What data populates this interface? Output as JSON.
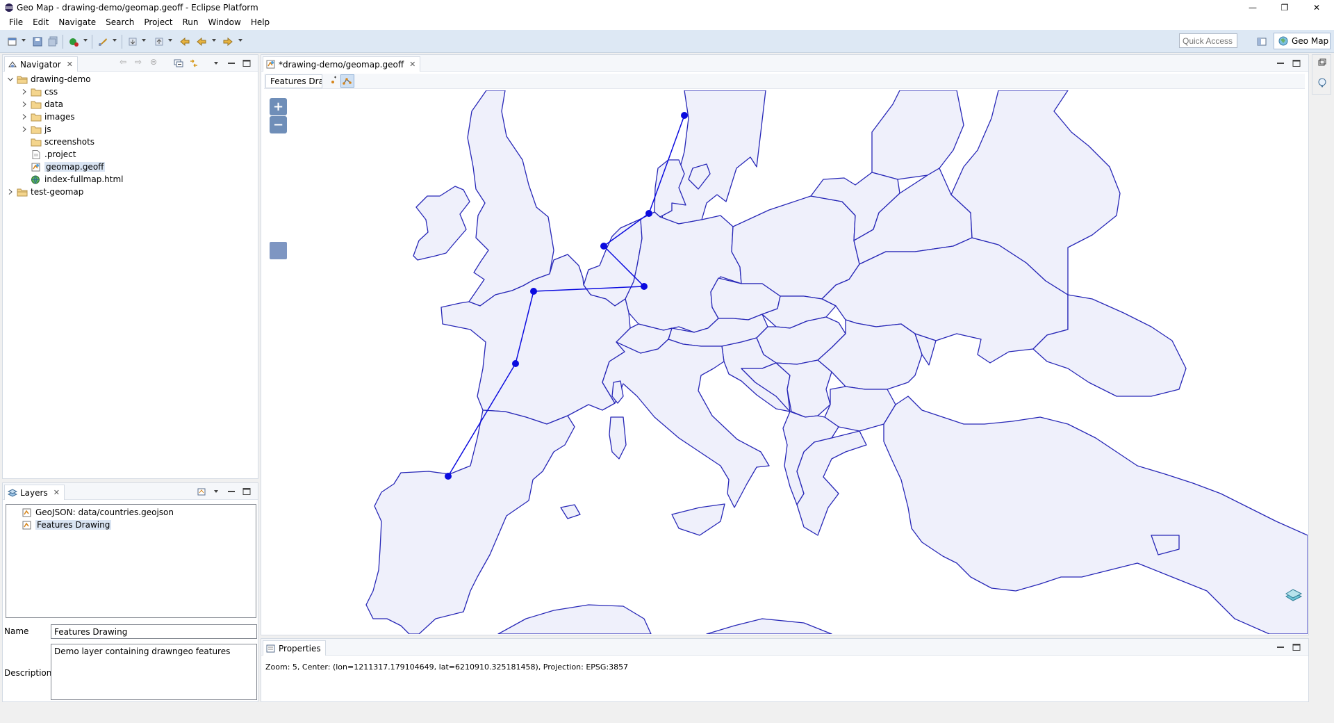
{
  "window": {
    "title": "Geo Map - drawing-demo/geomap.geoff - Eclipse Platform",
    "minimize": "—",
    "restore": "❐",
    "close": "✕"
  },
  "menu": [
    "File",
    "Edit",
    "Navigate",
    "Search",
    "Project",
    "Run",
    "Window",
    "Help"
  ],
  "toolbar": {
    "quick_access_placeholder": "Quick Access",
    "perspective_label": "Geo Map"
  },
  "navigator": {
    "tab_label": "Navigator",
    "tree": [
      {
        "label": "drawing-demo",
        "kind": "project",
        "expanded": true
      },
      {
        "label": "css",
        "kind": "folder"
      },
      {
        "label": "data",
        "kind": "folder"
      },
      {
        "label": "images",
        "kind": "folder"
      },
      {
        "label": "js",
        "kind": "folder"
      },
      {
        "label": "screenshots",
        "kind": "folder"
      },
      {
        "label": ".project",
        "kind": "file"
      },
      {
        "label": "geomap.geoff",
        "kind": "geoff",
        "selected": true
      },
      {
        "label": "index-fullmap.html",
        "kind": "html"
      },
      {
        "label": "test-geomap",
        "kind": "project",
        "expanded": false
      }
    ]
  },
  "layers": {
    "tab_label": "Layers",
    "items": [
      "GeoJSON: data/countries.geojson",
      "Features Drawing"
    ],
    "selected_index": 1,
    "name_label": "Name",
    "name_value": "Features Drawing",
    "description_label": "Description",
    "description_value": "Demo layer containing drawngeo features"
  },
  "editor": {
    "tab_label": "*drawing-demo/geomap.geoff",
    "toolbar_label": "Features Dra"
  },
  "map": {
    "zoom_in": "+",
    "zoom_out": "−",
    "fill_color": "#eff0fb",
    "border_color": "#2727b7",
    "feature_color": "#0b0bdf"
  },
  "properties": {
    "tab_label": "Properties",
    "status": "Zoom: 5, Center: (lon=1211317.179104649, lat=6210910.325181458), Projection: EPSG:3857"
  }
}
